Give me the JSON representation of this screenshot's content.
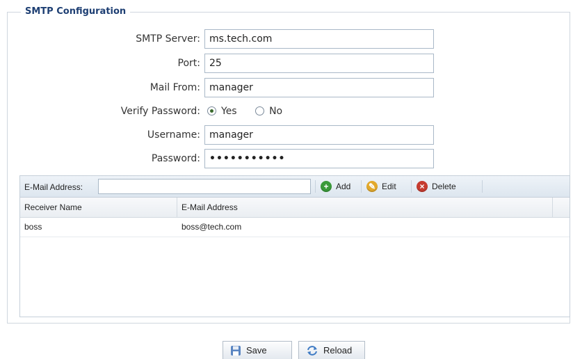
{
  "section": {
    "legend": "SMTP Configuration"
  },
  "form": {
    "smtp_server": {
      "label": "SMTP Server:",
      "value": "ms.tech.com"
    },
    "port": {
      "label": "Port:",
      "value": "25"
    },
    "mail_from": {
      "label": "Mail From:",
      "value": "manager"
    },
    "verify_password": {
      "label": "Verify Password:",
      "options": [
        "Yes",
        "No"
      ],
      "selected": "Yes"
    },
    "username": {
      "label": "Username:",
      "value": "manager"
    },
    "password": {
      "label": "Password:",
      "value": "•••••••••••"
    }
  },
  "grid": {
    "toolbar": {
      "email_label": "E-Mail Address:",
      "email_value": "",
      "add_label": "Add",
      "edit_label": "Edit",
      "delete_label": "Delete"
    },
    "columns": [
      "Receiver Name",
      "E-Mail Address"
    ],
    "rows": [
      {
        "receiver_name": "boss",
        "email": "boss@tech.com"
      }
    ]
  },
  "buttons": {
    "save_label": "Save",
    "reload_label": "Reload"
  },
  "icons": {
    "add": "add-circle-icon",
    "edit": "edit-circle-icon",
    "delete": "delete-circle-icon",
    "save": "floppy-disk-icon",
    "reload": "refresh-icon"
  },
  "colors": {
    "legend_text": "#1e3f73",
    "add_icon": "#3a9a3a",
    "edit_icon": "#e2a92c",
    "delete_icon": "#c63b2f"
  }
}
